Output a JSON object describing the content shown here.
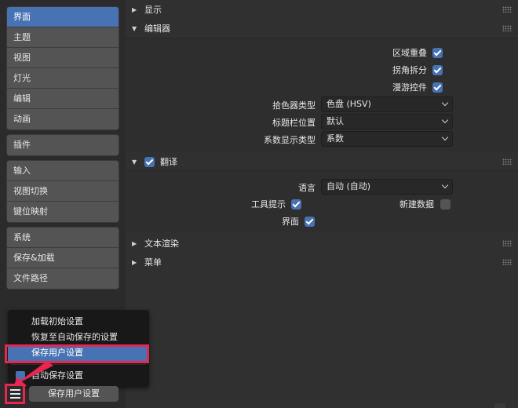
{
  "sidebar": {
    "group1": [
      "界面",
      "主题",
      "视图",
      "灯光",
      "编辑",
      "动画"
    ],
    "group2": [
      "插件"
    ],
    "group3": [
      "输入",
      "视图切换",
      "键位映射"
    ],
    "group4": [
      "系统",
      "保存&加载",
      "文件路径"
    ]
  },
  "panels": {
    "display": "显示",
    "editors": "编辑器",
    "translation": "翻译",
    "text_render": "文本渲染",
    "menus": "菜单"
  },
  "editors": {
    "region_overlap": "区域重叠",
    "corner_split": "拐角拆分",
    "navigation_controls": "漫游控件",
    "color_picker_label": "拾色器类型",
    "color_picker_value": "色盘 (HSV)",
    "header_position_label": "标题栏位置",
    "header_position_value": "默认",
    "factor_display_label": "系数显示类型",
    "factor_display_value": "系数"
  },
  "translation": {
    "language_label": "语言",
    "language_value": "自动 (自动)",
    "tooltips": "工具提示",
    "new_data": "新建数据",
    "interface": "界面"
  },
  "popup": {
    "load_factory": "加载初始设置",
    "revert_autosave": "恢复至自动保存的设置",
    "save_prefs": "保存用户设置",
    "auto_save": "自动保存设置"
  },
  "footer": {
    "save_button": "保存用户设置"
  },
  "colors": {
    "accent": "#4772b3",
    "annotation": "#e8264f"
  }
}
